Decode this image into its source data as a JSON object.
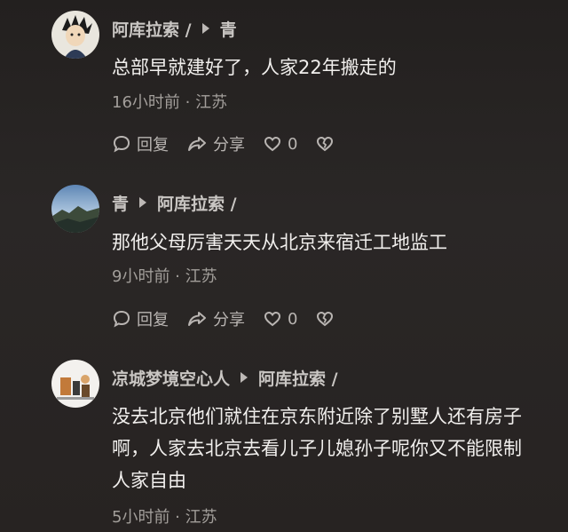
{
  "comments": [
    {
      "author": "阿库拉索 /",
      "reply_to": "青",
      "text": "总部早就建好了，人家22年搬走的",
      "time": "16小时前 · 江苏",
      "reply_label": "回复",
      "share_label": "分享",
      "like_count": "0"
    },
    {
      "author": "青",
      "reply_to": "阿库拉索 /",
      "text": "那他父母厉害天天从北京来宿迁工地监工",
      "time": "9小时前 · 江苏",
      "reply_label": "回复",
      "share_label": "分享",
      "like_count": "0"
    },
    {
      "author": "凉城梦境空心人",
      "reply_to": "阿库拉索 /",
      "text_lines": [
        "没去北京他们就住在京东附近除了别墅人还有房子",
        "啊，人家去北京去看儿子儿媳孙子呢你又不能限制",
        "人家自由"
      ],
      "time": "5小时前 · 江苏"
    }
  ],
  "icons": {
    "reply": "speech-bubble-icon",
    "share": "share-arrow-icon",
    "like": "heart-icon",
    "dislike": "broken-heart-icon",
    "reply_to_arrow": "triangle-right-icon"
  }
}
